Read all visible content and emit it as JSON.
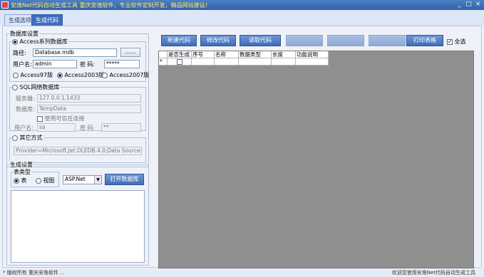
{
  "window": {
    "title": "安逸Net代码自动生成工具 重庆安逸软件，专业软件定制开发，精品网站建设！",
    "buttons": [
      "_",
      "□",
      "×"
    ]
  },
  "tabs": [
    {
      "label": "生成选项",
      "active": false
    },
    {
      "label": "生成代码",
      "active": true
    }
  ],
  "db_group": {
    "title": "数据库设置",
    "access": {
      "label": "Access系列数据库",
      "path_label": "路径:",
      "path_value": "Database.mdb",
      "browse": "......",
      "user_label": "用户名:",
      "user_value": "admin",
      "pwd_label": "密  码:",
      "pwd_value": "*****",
      "versions": [
        {
          "label": "Access97版",
          "selected": false
        },
        {
          "label": "Access2003版",
          "selected": true
        },
        {
          "label": "Access2007版",
          "selected": false
        }
      ]
    },
    "sql": {
      "label": "SQL网络数据库",
      "server_label": "服务器:",
      "server_value": "127.0.0.1,1433",
      "db_label": "数据库:",
      "db_value": "TempData",
      "trust_label": "使用可信任连接",
      "user_label": "用户名:",
      "user_value": "sa",
      "pwd_label": "密  码:",
      "pwd_value": "**"
    },
    "other": {
      "label": "其它方式",
      "conn_value": "Provider=Microsoft.Jet.OLEDB.4.0;Data Source=D:\\"
    }
  },
  "gen_group": {
    "title": "生成设置",
    "table_type_title": "表类型",
    "types": [
      {
        "label": "表",
        "selected": true
      },
      {
        "label": "视图",
        "selected": false
      }
    ],
    "lang_value": "ASP.Net",
    "open_btn": "打开数据库"
  },
  "toolbar": {
    "buttons": [
      {
        "label": "新建代码",
        "enabled": true
      },
      {
        "label": "修改代码",
        "enabled": true
      },
      {
        "label": "读取代码",
        "enabled": true
      },
      {
        "label": "",
        "enabled": false
      },
      {
        "label": "",
        "enabled": false
      },
      {
        "label": "",
        "enabled": false
      },
      {
        "label": "打印表格",
        "enabled": true
      }
    ],
    "select_all": "全选"
  },
  "grid": {
    "columns": [
      "是否生成",
      "序号",
      "名称",
      "数据类型",
      "长度",
      "功能说明"
    ],
    "new_row_marker": "*"
  },
  "statusbar": {
    "left": "* 版权所有 重庆安逸软件 ...",
    "right": "欢迎您使用安逸Net代码自动生成工具"
  }
}
